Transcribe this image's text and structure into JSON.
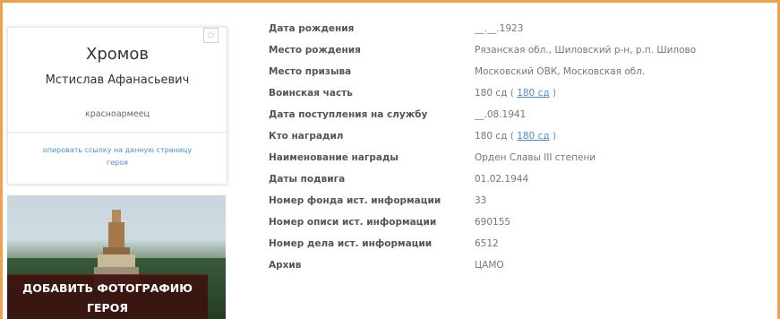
{
  "hero": {
    "surname": "Хромов",
    "given_names": "Мстислав Афанасьевич",
    "rank": "красноармеец",
    "copy_link_line1": "опировать ссылку на данную страницу",
    "copy_link_line2": "героя",
    "favorite_icon": "star-icon"
  },
  "photo_button": {
    "line1": "ДОБАВИТЬ ФОТОГРАФИЮ",
    "line2": "ГЕРОЯ"
  },
  "details": [
    {
      "label": "Дата рождения",
      "value": "__.__.1923"
    },
    {
      "label": "Место рождения",
      "value": "Рязанская обл., Шиловский р-н, р.п. Шилово"
    },
    {
      "label": "Место призыва",
      "value": "Московский ОВК, Московская обл."
    },
    {
      "label": "Воинская часть",
      "value": "180 сд",
      "link": "180 сд"
    },
    {
      "label": "Дата поступления на службу",
      "value": "__.08.1941"
    },
    {
      "label": "Кто наградил",
      "value": "180 сд",
      "link": "180 сд"
    },
    {
      "label": "Наименование награды",
      "value": "Орден Славы III степени"
    },
    {
      "label": "Даты подвига",
      "value": "01.02.1944"
    },
    {
      "label": "Номер фонда ист. информации",
      "value": "33"
    },
    {
      "label": "Номер описи ист. информации",
      "value": "690155"
    },
    {
      "label": "Номер дела ист. информации",
      "value": "6512"
    },
    {
      "label": "Архив",
      "value": "ЦАМО"
    }
  ],
  "colors": {
    "frame_border": "#f0a050",
    "link": "#4a8fcf",
    "label": "#555555",
    "value": "#777777",
    "photo_button_bg": "#3c120e"
  }
}
